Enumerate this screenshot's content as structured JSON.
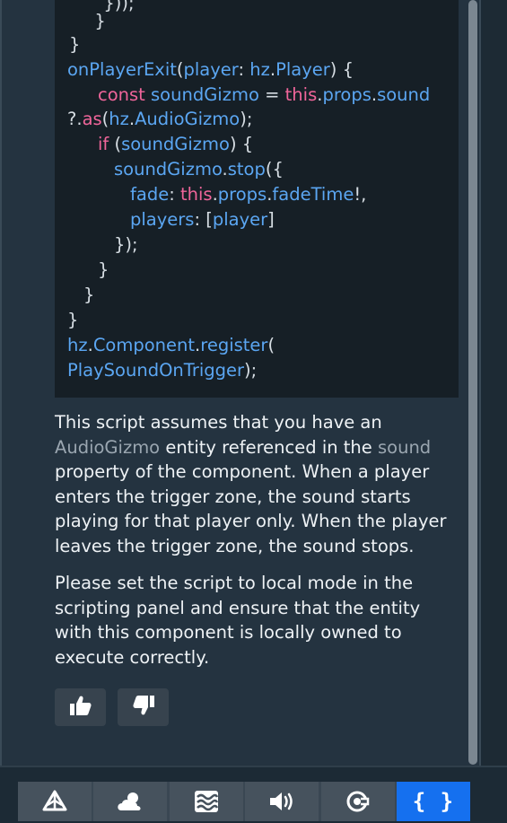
{
  "code": {
    "lines": [
      [
        {
          "t": "pl",
          "v": "  }));"
        }
      ],
      [
        {
          "t": "pl",
          "v": "  }"
        }
      ],
      [
        {
          "t": "pl",
          "v": "}"
        }
      ],
      [
        {
          "t": "fn",
          "v": "onPlayerExit"
        },
        {
          "t": "pl",
          "v": "("
        },
        {
          "t": "fn",
          "v": "player"
        },
        {
          "t": "pl",
          "v": ": "
        },
        {
          "t": "fn",
          "v": "hz"
        },
        {
          "t": "pl",
          "v": "."
        },
        {
          "t": "fn",
          "v": "Player"
        },
        {
          "t": "pl",
          "v": ") {"
        }
      ],
      [
        {
          "t": "kw",
          "v": "const "
        },
        {
          "t": "fn",
          "v": "soundGizmo"
        },
        {
          "t": "pl",
          "v": " = "
        },
        {
          "t": "kw",
          "v": "this"
        },
        {
          "t": "pl",
          "v": "."
        },
        {
          "t": "fn",
          "v": "props"
        },
        {
          "t": "pl",
          "v": "."
        },
        {
          "t": "fn",
          "v": "sound"
        }
      ],
      [
        {
          "t": "pl",
          "v": "?."
        },
        {
          "t": "kw",
          "v": "as"
        },
        {
          "t": "pl",
          "v": "("
        },
        {
          "t": "fn",
          "v": "hz"
        },
        {
          "t": "pl",
          "v": "."
        },
        {
          "t": "fn",
          "v": "AudioGizmo"
        },
        {
          "t": "pl",
          "v": ");"
        }
      ],
      [
        {
          "t": "kw",
          "v": "if "
        },
        {
          "t": "pl",
          "v": "("
        },
        {
          "t": "fn",
          "v": "soundGizmo"
        },
        {
          "t": "pl",
          "v": ") {"
        }
      ],
      [
        {
          "t": "fn",
          "v": "soundGizmo"
        },
        {
          "t": "pl",
          "v": "."
        },
        {
          "t": "fn",
          "v": "stop"
        },
        {
          "t": "pl",
          "v": "({"
        }
      ],
      [
        {
          "t": "fn",
          "v": "fade"
        },
        {
          "t": "pl",
          "v": ": "
        },
        {
          "t": "kw",
          "v": "this"
        },
        {
          "t": "pl",
          "v": "."
        },
        {
          "t": "fn",
          "v": "props"
        },
        {
          "t": "pl",
          "v": "."
        },
        {
          "t": "fn",
          "v": "fadeTime"
        },
        {
          "t": "pl",
          "v": "!,"
        }
      ],
      [
        {
          "t": "fn",
          "v": "players"
        },
        {
          "t": "pl",
          "v": ": ["
        },
        {
          "t": "fn",
          "v": "player"
        },
        {
          "t": "pl",
          "v": "]"
        }
      ],
      [
        {
          "t": "pl",
          "v": "});"
        }
      ],
      [
        {
          "t": "pl",
          "v": "}"
        }
      ],
      [
        {
          "t": "pl",
          "v": "}"
        }
      ],
      [
        {
          "t": "pl",
          "v": "}"
        }
      ],
      [
        {
          "t": "fn",
          "v": "hz"
        },
        {
          "t": "pl",
          "v": "."
        },
        {
          "t": "fn",
          "v": "Component"
        },
        {
          "t": "pl",
          "v": "."
        },
        {
          "t": "fn",
          "v": "register"
        },
        {
          "t": "pl",
          "v": "("
        }
      ],
      [
        {
          "t": "fn",
          "v": "PlaySoundOnTrigger"
        },
        {
          "t": "pl",
          "v": ");"
        }
      ]
    ]
  },
  "paragraph1": {
    "lines": [
      [
        {
          "t": "n",
          "v": "This script assumes that you have an"
        }
      ],
      [
        {
          "t": "r",
          "v": "AudioGizmo"
        },
        {
          "t": "n",
          "v": " entity referenced in the "
        },
        {
          "t": "r",
          "v": "sound"
        }
      ],
      [
        {
          "t": "n",
          "v": "property of the component. When a player"
        }
      ],
      [
        {
          "t": "n",
          "v": "enters the trigger zone, the sound starts"
        }
      ],
      [
        {
          "t": "n",
          "v": "playing for that player only. When the player"
        }
      ],
      [
        {
          "t": "n",
          "v": "leaves the trigger zone, the sound stops."
        }
      ]
    ]
  },
  "paragraph2": {
    "lines": [
      [
        {
          "t": "n",
          "v": "Please set the script to local mode in the"
        }
      ],
      [
        {
          "t": "n",
          "v": "scripting panel and ensure that the entity"
        }
      ],
      [
        {
          "t": "n",
          "v": "with this component is locally owned to"
        }
      ],
      [
        {
          "t": "n",
          "v": "execute correctly."
        }
      ]
    ]
  },
  "feedback": {
    "like_icon": "thumbs-up-icon",
    "dislike_icon": "thumbs-down-icon"
  },
  "toolbar": {
    "buttons": [
      {
        "icon": "terrain-pyramid-icon",
        "active": false
      },
      {
        "icon": "cloud-sun-icon",
        "active": false
      },
      {
        "icon": "water-waves-icon",
        "active": false
      },
      {
        "icon": "speaker-volume-icon",
        "active": false
      },
      {
        "icon": "gizmo-target-icon",
        "active": false
      },
      {
        "icon": "code-braces-icon",
        "active": true,
        "label": "{ }"
      }
    ],
    "active_color": "#1570ef"
  },
  "colors": {
    "keyword": "#f0659a",
    "identifier": "#5ba6f2",
    "plain": "#d6dde3",
    "reference_text": "#9aa6b0"
  }
}
